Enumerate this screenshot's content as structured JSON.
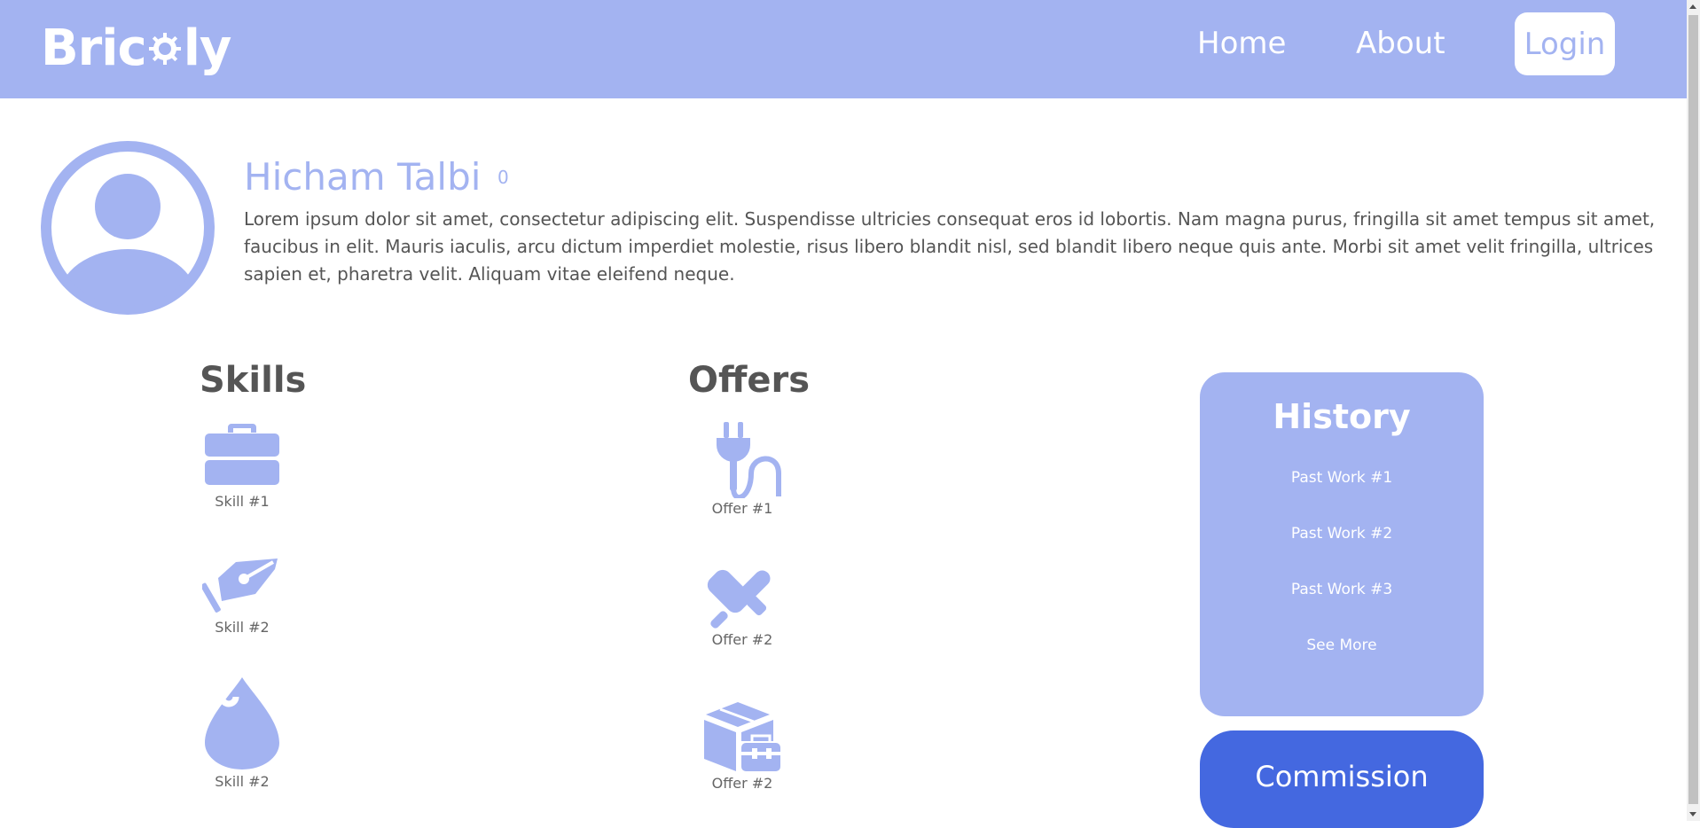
{
  "colors": {
    "accent": "#a3b3f1",
    "commission_button": "#4468e0",
    "text": "#555555",
    "white": "#ffffff"
  },
  "header": {
    "logo_text_left": "Bric",
    "logo_text_right": "ly",
    "logo_icon": "gear-icon",
    "nav": {
      "home": "Home",
      "about": "About",
      "login": "Login"
    }
  },
  "profile": {
    "avatar_icon": "user-avatar-icon",
    "name": "Hicham Talbi",
    "rating": "0",
    "bio": "Lorem ipsum dolor sit amet, consectetur adipiscing elit. Suspendisse ultricies consequat eros id lobortis. Nam magna purus, fringilla sit amet tempus sit amet, faucibus in elit. Mauris iaculis, arcu dictum imperdiet molestie, risus libero blandit nisl, sed blandit libero neque quis ante. Morbi sit amet velit fringilla, ultrices sapien et, pharetra velit. Aliquam vitae eleifend neque."
  },
  "skills": {
    "title": "Skills",
    "items": [
      {
        "label": "Skill #1",
        "icon": "briefcase-icon"
      },
      {
        "label": "Skill #2",
        "icon": "pen-nib-icon"
      },
      {
        "label": "Skill #2",
        "icon": "fire-drop-icon"
      }
    ]
  },
  "offers": {
    "title": "Offers",
    "items": [
      {
        "label": "Offer #1",
        "icon": "plug-icon"
      },
      {
        "label": "Offer #2",
        "icon": "tools-icon"
      },
      {
        "label": "Offer #2",
        "icon": "box-toolbox-icon"
      }
    ]
  },
  "history": {
    "title": "History",
    "items": [
      "Past Work #1",
      "Past Work #2",
      "Past Work #3"
    ],
    "see_more": "See More"
  },
  "commission_label": "Commission"
}
